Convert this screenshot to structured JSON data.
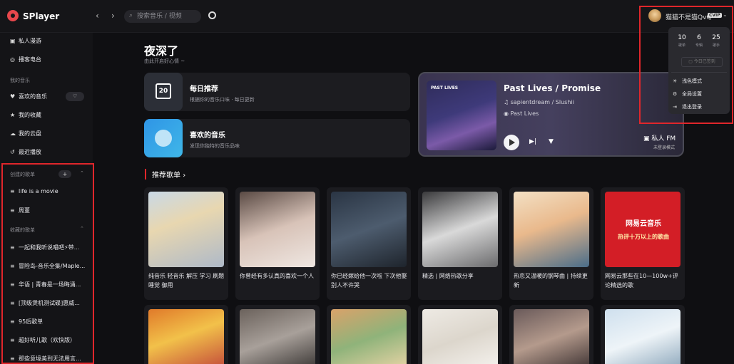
{
  "app": {
    "name": "SPlayer"
  },
  "topbar": {
    "back": "‹",
    "forward": "›",
    "search_placeholder": "搜索音乐 / 视频",
    "username": "猫猫不是猫QvQ",
    "vip": "CVIP"
  },
  "sidebar": {
    "top_items": [
      {
        "label": "私人漫游",
        "icon": "radio-icon"
      },
      {
        "label": "播客电台",
        "icon": "podcast-icon"
      }
    ],
    "my_music_header": "我的音乐",
    "my_items": [
      {
        "label": "喜欢的音乐",
        "icon": "heart-icon"
      },
      {
        "label": "我的收藏",
        "icon": "star-icon"
      },
      {
        "label": "我的云盘",
        "icon": "cloud-icon"
      },
      {
        "label": "最近播放",
        "icon": "history-icon"
      }
    ],
    "created_header": "创建的歌单",
    "created_items": [
      "life is a movie",
      "周董"
    ],
    "collected_header": "收藏的歌单",
    "collected_items": [
      "一起和我听说唱吧⚡带...",
      "冒险岛-音乐全集/Maple...",
      "华语 | 青春是一场晦涌...",
      "[顶级煲机测试碟]惠威...",
      "95后歌单",
      "超好听儿歌（欢快版）",
      "那些意境美到无法用言..."
    ]
  },
  "main": {
    "greeting": "夜深了",
    "greeting_sub": "由此开启好心情 ~",
    "daily": {
      "day": "20",
      "title": "每日推荐",
      "subtitle": "根据你的音乐口味 · 每日更新"
    },
    "liked": {
      "title": "喜欢的音乐",
      "subtitle": "发现你独特的音乐品味"
    },
    "fm": {
      "cover_title": "PAST LIVES",
      "song": "Past Lives / Promise",
      "artist": "sapientdream / Slushii",
      "album": "Past Lives",
      "label": "私人 FM",
      "sublabel": "未登录模式"
    },
    "section_title": "推荐歌单",
    "playlists": [
      "纯音乐 轻音乐 解压 学习 刷题 睡觉 御用",
      "你曾经有多认真的喜欢一个人",
      "你已经嫁给他一次啦 下次他娶别人不许哭",
      "精选 | 网络热歌分享",
      "热恋又温暖的钢琴曲 | 持续更新",
      "网易云那些在10—100w+评论精选的歌"
    ],
    "netease_cover": {
      "brand": "网易云音乐",
      "caption": "热评十万以上的歌曲"
    }
  },
  "menu": {
    "stats": [
      {
        "num": "10",
        "label": "歌单"
      },
      {
        "num": "6",
        "label": "专辑"
      },
      {
        "num": "25",
        "label": "歌手"
      }
    ],
    "signin": "今日已签到",
    "items": [
      {
        "label": "浅色模式",
        "icon": "sun-icon"
      },
      {
        "label": "全局设置",
        "icon": "gear-icon"
      },
      {
        "label": "退出登录",
        "icon": "logout-icon"
      }
    ]
  },
  "colors": {
    "accent": "#e0262b",
    "bg": "#0f0f12",
    "card": "#1c1c20"
  }
}
